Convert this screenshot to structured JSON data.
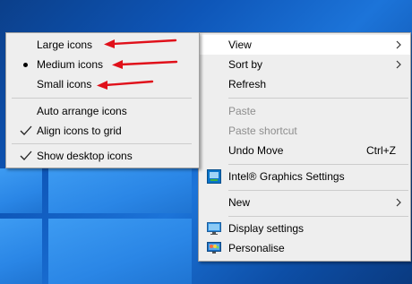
{
  "submenu": {
    "items": [
      {
        "label": "Large icons"
      },
      {
        "label": "Medium icons",
        "selected": true
      },
      {
        "label": "Small icons"
      },
      {
        "label": "Auto arrange icons"
      },
      {
        "label": "Align icons to grid",
        "checked": true
      },
      {
        "label": "Show desktop icons",
        "checked": true
      }
    ]
  },
  "context_menu": {
    "view": "View",
    "sort_by": "Sort by",
    "refresh": "Refresh",
    "paste": "Paste",
    "paste_shortcut": "Paste shortcut",
    "undo_move": "Undo Move",
    "undo_move_shortcut": "Ctrl+Z",
    "intel_graphics": "Intel® Graphics Settings",
    "new": "New",
    "display_settings": "Display settings",
    "personalise": "Personalise"
  },
  "colors": {
    "menu_bg": "#eeeeee",
    "highlight": "#ffffff",
    "disabled_text": "#8e8e8e",
    "annotation_arrow": "#e0101a",
    "desktop_blue": "#0e56b8"
  },
  "icons": {
    "submenu_arrow": "chevron-right-icon",
    "selected": "bullet-icon",
    "checked": "checkmark-icon",
    "intel": "intel-graphics-icon",
    "display": "display-settings-icon",
    "personalise": "personalise-icon"
  }
}
